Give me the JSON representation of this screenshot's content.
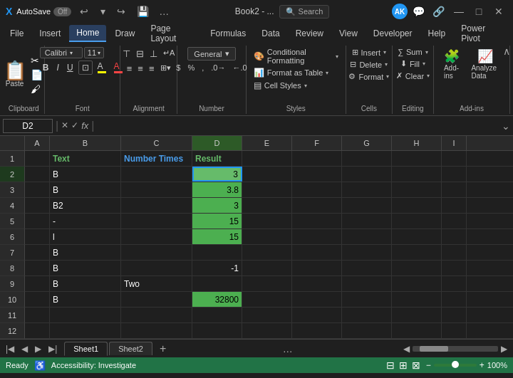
{
  "titleBar": {
    "appIcon": "X",
    "autoSaveLabel": "AutoSave",
    "autoSaveState": "Off",
    "fileName": "Book2 - ...",
    "searchPlaceholder": "Search",
    "avatarInitials": "AK",
    "undoLabel": "↩",
    "redoLabel": "↪",
    "minimizeLabel": "—",
    "maximizeLabel": "□",
    "closeLabel": "✕"
  },
  "ribbon": {
    "tabs": [
      "File",
      "Insert",
      "Home",
      "Draw",
      "Page Layout",
      "Formulas",
      "Data",
      "Review",
      "View",
      "Developer",
      "Help",
      "Power Pivot"
    ],
    "activeTab": "Home",
    "collapseLabel": "∧",
    "groups": {
      "clipboard": {
        "label": "Clipboard",
        "pasteIcon": "📋",
        "items": [
          "✂",
          "📄",
          "🖌"
        ]
      },
      "font": {
        "label": "Font",
        "icon": "A"
      },
      "alignment": {
        "label": "Alignment",
        "icon": "≡"
      },
      "number": {
        "label": "Number",
        "displayText": "General",
        "dropdownArrow": "▾"
      },
      "styles": {
        "label": "Styles",
        "conditionalFormatting": "Conditional Formatting",
        "formatAsTable": "Format as Table",
        "cellStyles": "Cell Styles",
        "dropdownArrow": "▾"
      },
      "cells": {
        "label": "Cells",
        "icon": "⊞"
      },
      "editing": {
        "label": "Editing",
        "icon": "∑"
      },
      "addins": {
        "label": "Add-ins",
        "items": [
          "Add-ins",
          "Analyze Data"
        ]
      }
    }
  },
  "formulaBar": {
    "cellRef": "D2",
    "cancelIcon": "✕",
    "confirmIcon": "✓",
    "functionIcon": "fx",
    "value": "",
    "expandIcon": "⌄"
  },
  "spreadsheet": {
    "columns": [
      "A",
      "B",
      "C",
      "D",
      "E",
      "F",
      "G",
      "H",
      "I"
    ],
    "activeCol": "D",
    "rows": [
      {
        "num": 1,
        "cells": [
          "",
          "Text",
          "Number Times",
          "Result",
          "",
          "",
          "",
          "",
          ""
        ]
      },
      {
        "num": 2,
        "cells": [
          "",
          "B",
          "",
          "3",
          "",
          "",
          "",
          "",
          ""
        ]
      },
      {
        "num": 3,
        "cells": [
          "",
          "B",
          "",
          "3.8",
          "",
          "",
          "",
          "",
          ""
        ]
      },
      {
        "num": 4,
        "cells": [
          "",
          "B2",
          "",
          "3",
          "",
          "",
          "",
          "",
          ""
        ]
      },
      {
        "num": 5,
        "cells": [
          "",
          "-",
          "",
          "15",
          "",
          "",
          "",
          "",
          ""
        ]
      },
      {
        "num": 6,
        "cells": [
          "",
          "l",
          "",
          "15",
          "",
          "",
          "",
          "",
          ""
        ]
      },
      {
        "num": 7,
        "cells": [
          "",
          "B",
          "",
          "",
          "",
          "",
          "",
          "",
          ""
        ]
      },
      {
        "num": 8,
        "cells": [
          "",
          "B",
          "",
          "-1",
          "",
          "",
          "",
          "",
          ""
        ]
      },
      {
        "num": 9,
        "cells": [
          "",
          "B",
          "Two",
          "",
          "",
          "",
          "",
          "",
          ""
        ]
      },
      {
        "num": 10,
        "cells": [
          "",
          "B",
          "",
          "32800",
          "",
          "",
          "",
          "",
          ""
        ]
      },
      {
        "num": 11,
        "cells": [
          "",
          "",
          "",
          "",
          "",
          "",
          "",
          "",
          ""
        ]
      },
      {
        "num": 12,
        "cells": [
          "",
          "",
          "",
          "",
          "",
          "",
          "",
          "",
          ""
        ]
      }
    ],
    "greenRows": [
      2,
      3,
      4,
      5,
      6,
      10
    ],
    "selectedCell": "D2"
  },
  "sheets": {
    "tabs": [
      "Sheet1",
      "Sheet2"
    ],
    "activeSheet": "Sheet1",
    "addLabel": "+"
  },
  "statusBar": {
    "readyLabel": "Ready",
    "accessibilityLabel": "Accessibility: Investigate",
    "zoomLabel": "100%"
  }
}
